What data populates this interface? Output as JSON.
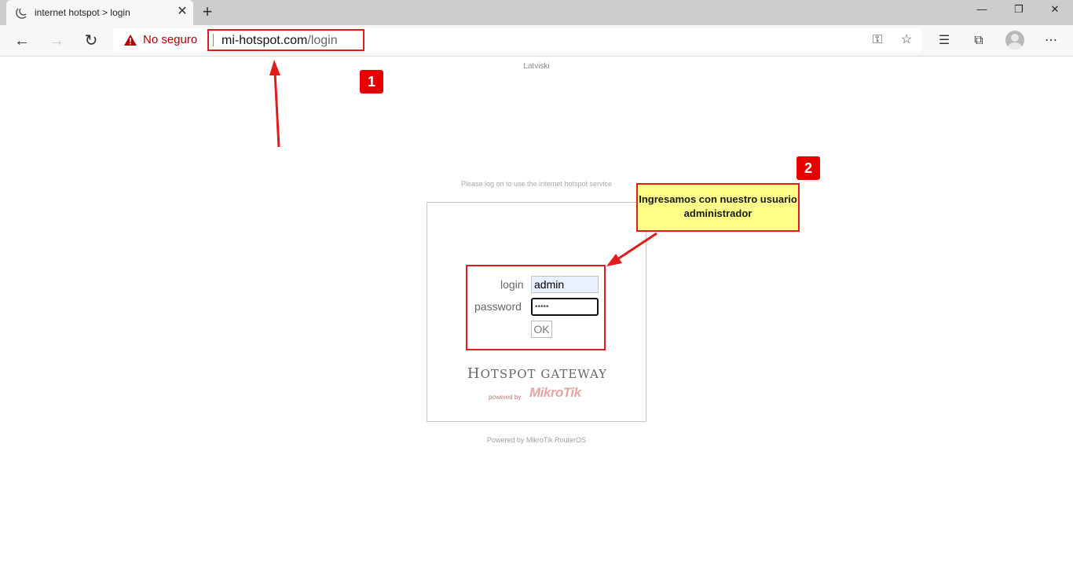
{
  "browser": {
    "tab_title": "internet hotspot > login",
    "tab_close": "✕",
    "new_tab": "+",
    "window_controls": {
      "minimize": "—",
      "restore": "❐",
      "close": "✕"
    },
    "security_label": "No seguro",
    "url_host": "mi-hotspot.com",
    "url_path": "/login"
  },
  "page": {
    "language_link": "Latviski",
    "subtitle": "Please log on to use the internet hotspot service",
    "login_label": "login",
    "login_value": "admin",
    "password_label": "password",
    "password_value": "•••••",
    "ok_button": "OK",
    "hotspot_title_h": "H",
    "hotspot_title_rest": "OTSPOT GATEWAY",
    "powered_by_small": "powered by",
    "mikrotik_logo_text": "MikroTik",
    "footer": "Powered by MikroTik RouterOS"
  },
  "annotations": {
    "badge_1": "1",
    "badge_2": "2",
    "callout_text": "Ingresamos con nuestro usuario administrador",
    "color": "#e21b1b",
    "callout_bg": "#ffff8a"
  }
}
